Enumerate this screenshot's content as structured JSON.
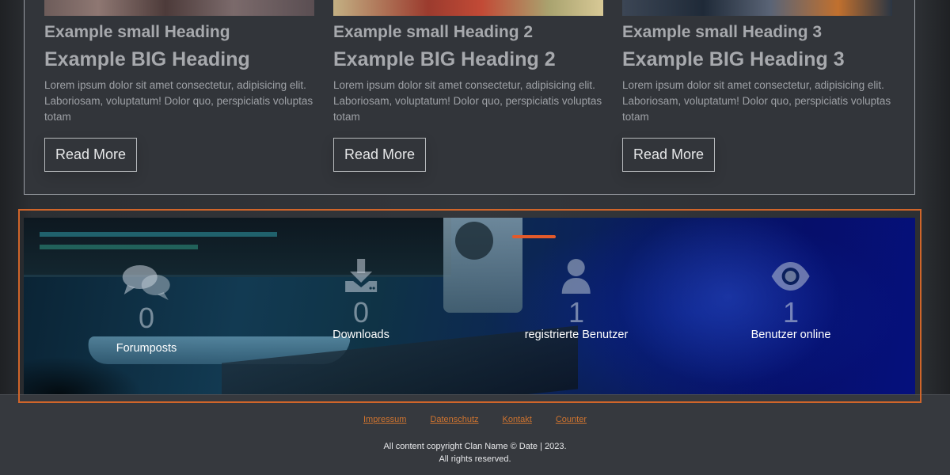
{
  "cards": [
    {
      "small_heading": "Example small Heading",
      "big_heading": "Example BIG Heading",
      "text": "Lorem ipsum dolor sit amet consectetur, adipisicing elit. Laboriosam, voluptatum! Dolor quo, perspiciatis voluptas totam",
      "button_label": "Read More"
    },
    {
      "small_heading": "Example small Heading 2",
      "big_heading": "Example BIG Heading 2",
      "text": "Lorem ipsum dolor sit amet consectetur, adipisicing elit. Laboriosam, voluptatum! Dolor quo, perspiciatis voluptas totam",
      "button_label": "Read More"
    },
    {
      "small_heading": "Example small Heading 3",
      "big_heading": "Example BIG Heading 3",
      "text": "Lorem ipsum dolor sit amet consectetur, adipisicing elit. Laboriosam, voluptatum! Dolor quo, perspiciatis voluptas totam",
      "button_label": "Read More"
    }
  ],
  "stats": [
    {
      "icon": "comments-icon",
      "value": "0",
      "label": "Forumposts"
    },
    {
      "icon": "download-icon",
      "value": "0",
      "label": "Downloads"
    },
    {
      "icon": "user-icon",
      "value": "1",
      "label": "registrierte Benutzer"
    },
    {
      "icon": "eye-icon",
      "value": "1",
      "label": "Benutzer online"
    }
  ],
  "footer": {
    "links": [
      "Impressum",
      "Datenschutz",
      "Kontakt",
      "Counter"
    ],
    "copyright_line1": "All content copyright Clan Name © Date | 2023.",
    "copyright_line2": "All rights reserved."
  },
  "colors": {
    "accent": "#d0652a",
    "link": "#d0742f",
    "panel_bg": "#32353a",
    "footer_bg": "#36393e"
  }
}
